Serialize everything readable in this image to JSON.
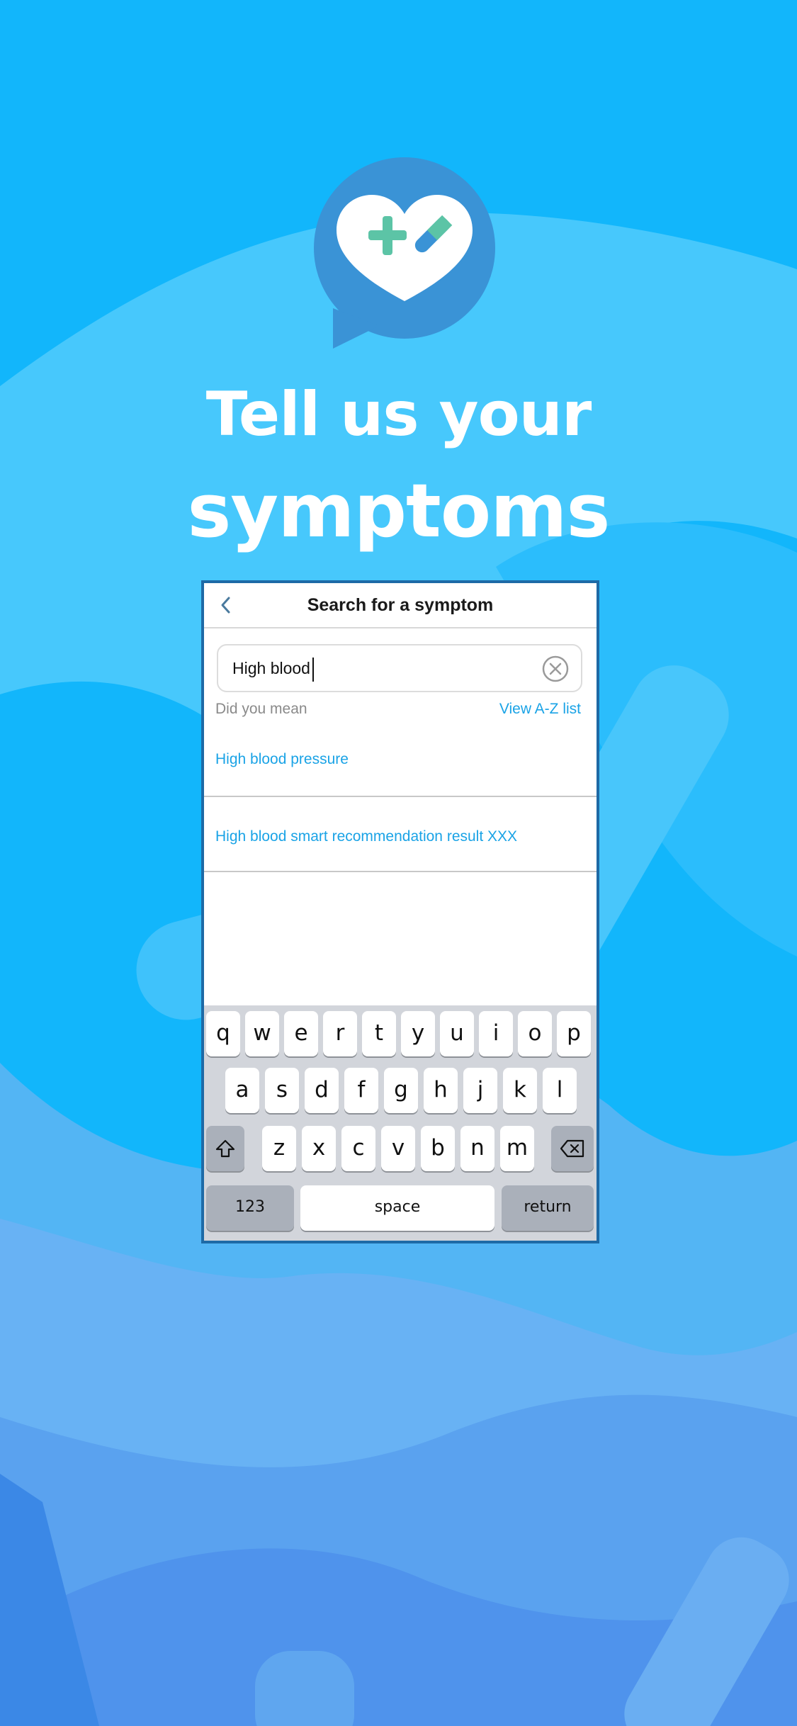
{
  "headline": {
    "line1": "Tell us your",
    "line2": "symptoms"
  },
  "logo": {
    "icon": "heart-bandage-chat-icon"
  },
  "colors": {
    "background": "#12b6fb",
    "accent": "#1aa3e6",
    "logo_bubble": "#3a93d6",
    "logo_cross": "#5cc4a6",
    "phone_border": "#1e6aa6"
  },
  "screen": {
    "title": "Search for a symptom",
    "back_icon": "chevron-left-icon",
    "search": {
      "value": "High blood",
      "clear_icon": "clear-circle-icon"
    },
    "did_you_mean": "Did you mean",
    "view_az": "View A-Z list",
    "results": [
      "High blood pressure",
      "High blood smart recommendation result XXX"
    ]
  },
  "keyboard": {
    "row1": [
      "q",
      "w",
      "e",
      "r",
      "t",
      "y",
      "u",
      "i",
      "o",
      "p"
    ],
    "row2": [
      "a",
      "s",
      "d",
      "f",
      "g",
      "h",
      "j",
      "k",
      "l"
    ],
    "row3": [
      "z",
      "x",
      "c",
      "v",
      "b",
      "n",
      "m"
    ],
    "shift_icon": "shift-icon",
    "delete_icon": "backspace-icon",
    "numbers": "123",
    "space": "space",
    "return": "return"
  }
}
